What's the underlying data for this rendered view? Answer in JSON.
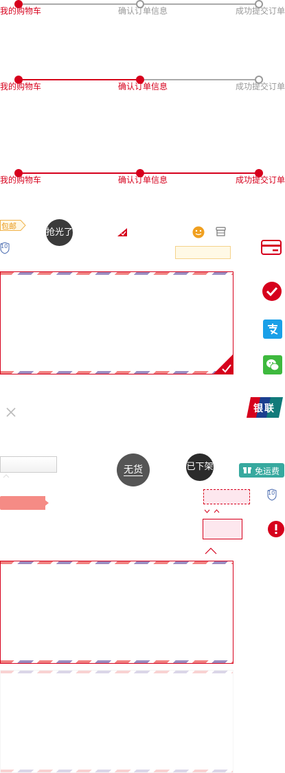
{
  "steppers": [
    {
      "labels": [
        "我的购物车",
        "确认订单信息",
        "成功提交订单"
      ],
      "active": 1
    },
    {
      "labels": [
        "我的购物车",
        "确认订单信息",
        "成功提交订单"
      ],
      "active": 2
    },
    {
      "labels": [
        "我的购物车",
        "确认订单信息",
        "成功提交订单"
      ],
      "active": 3
    }
  ],
  "badges": {
    "free_shipping_tag": "包邮",
    "sold_out": "抢光了",
    "no_stock": "无货",
    "off_shelf": "已下架",
    "free_shipping_button": "免运费",
    "coupon_value_1": "10",
    "coupon_value_2": "10"
  },
  "payment_icons": [
    "bank-card-icon",
    "check-circle-icon",
    "alipay-icon",
    "wechat-pay-icon",
    "unionpay-icon"
  ],
  "unionpay_text": "银联",
  "colors": {
    "brand_red": "#d6001c",
    "gray": "#999999",
    "alipay_blue": "#1aa0e8",
    "wechat_green": "#3eb93e",
    "teal": "#37a99f"
  }
}
